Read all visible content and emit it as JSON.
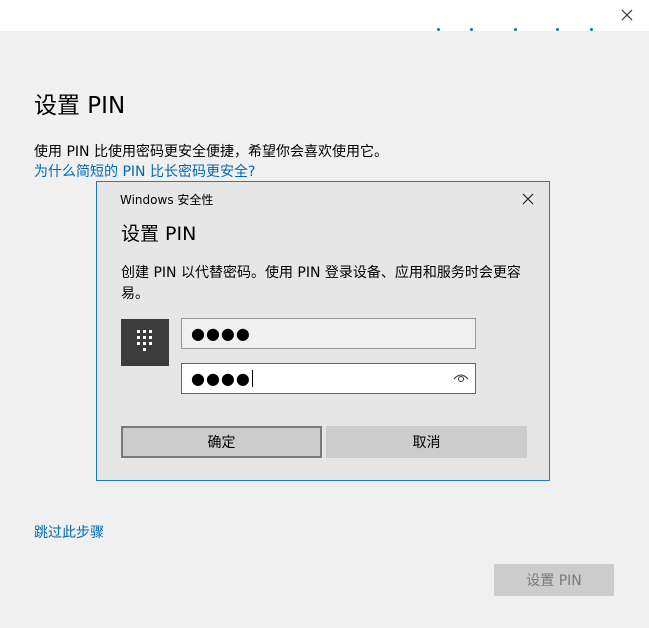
{
  "page": {
    "title": "设置 PIN",
    "description": "使用 PIN 比使用密码更安全便捷，希望你会喜欢使用它。",
    "why_link": "为什么简短的 PIN 比长密码更安全?",
    "skip_link": "跳过此步骤",
    "setpin_button": "设置 PIN"
  },
  "dialog": {
    "caption": "Windows 安全性",
    "title": "设置 PIN",
    "description": "创建 PIN 以代替密码。使用 PIN 登录设备、应用和服务时会更容易。",
    "pin_value": "●●●●",
    "confirm_value": "●●●●",
    "ok_label": "确定",
    "cancel_label": "取消"
  },
  "icons": {
    "window_close": "close-icon",
    "dialog_close": "close-icon",
    "keypad": "keypad-icon",
    "reveal": "eye-icon"
  },
  "colors": {
    "accent": "#0078d7",
    "link": "#0067b8",
    "dialog_border": "#1c78c8"
  }
}
